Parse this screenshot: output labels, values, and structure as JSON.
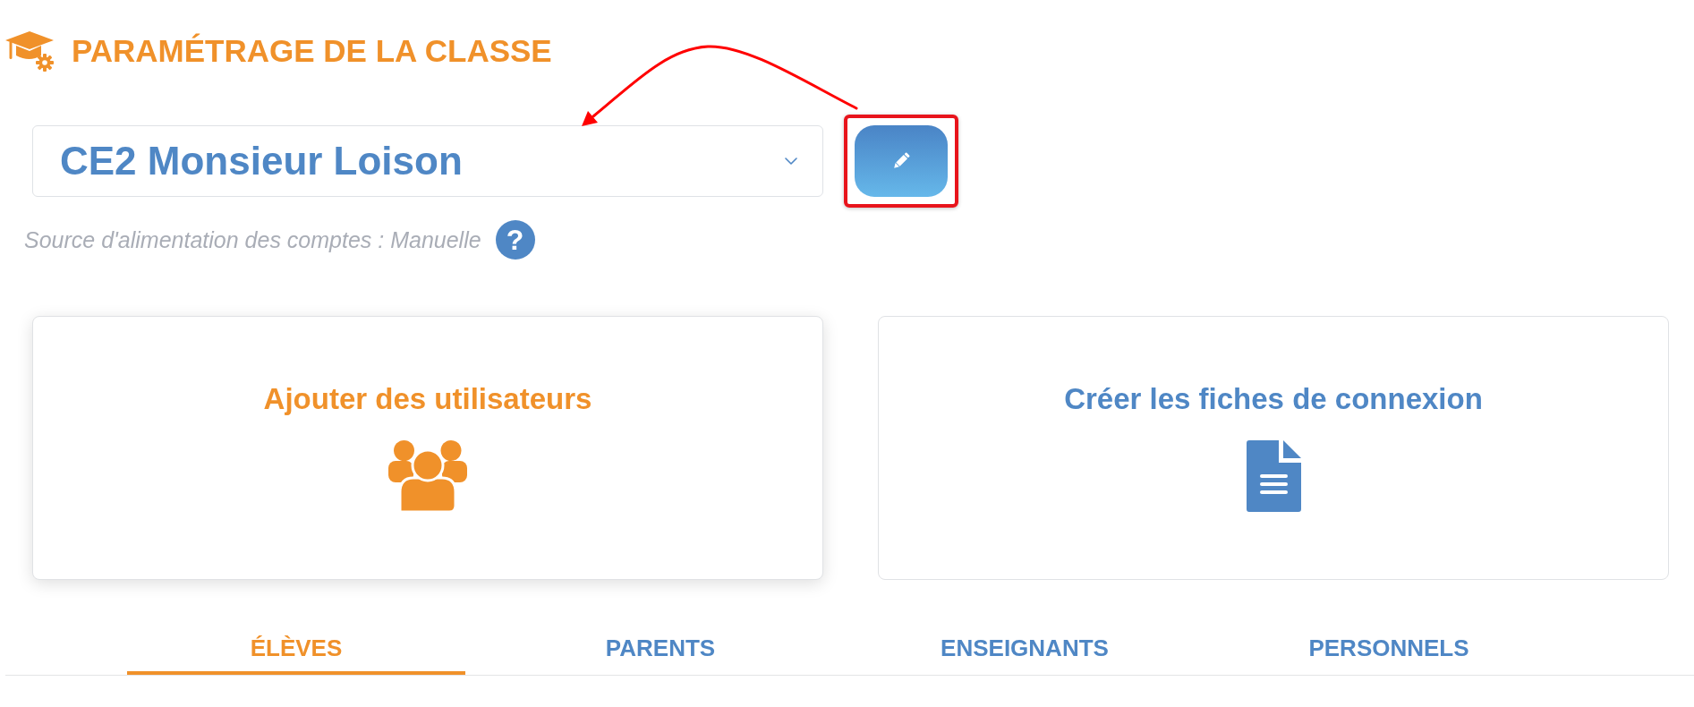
{
  "page_title": "PARAMÉTRAGE DE LA CLASSE",
  "class_select": {
    "value": "CE2 Monsieur Loison"
  },
  "edit_button": {
    "highlighted": true
  },
  "source_note": "Source d'alimentation des comptes : Manuelle",
  "help_button": {
    "label": "?"
  },
  "cards": [
    {
      "title": "Ajouter des utilisateurs",
      "kind": "users",
      "color": "#f0912a",
      "hovered": true
    },
    {
      "title": "Créer les fiches de connexion",
      "kind": "document",
      "color": "#4f87c5",
      "hovered": false
    }
  ],
  "tabs": [
    {
      "label": "ÉLÈVES",
      "selected": true
    },
    {
      "label": "PARENTS",
      "selected": false
    },
    {
      "label": "ENSEIGNANTS",
      "selected": false
    },
    {
      "label": "PERSONNELS",
      "selected": false
    }
  ]
}
